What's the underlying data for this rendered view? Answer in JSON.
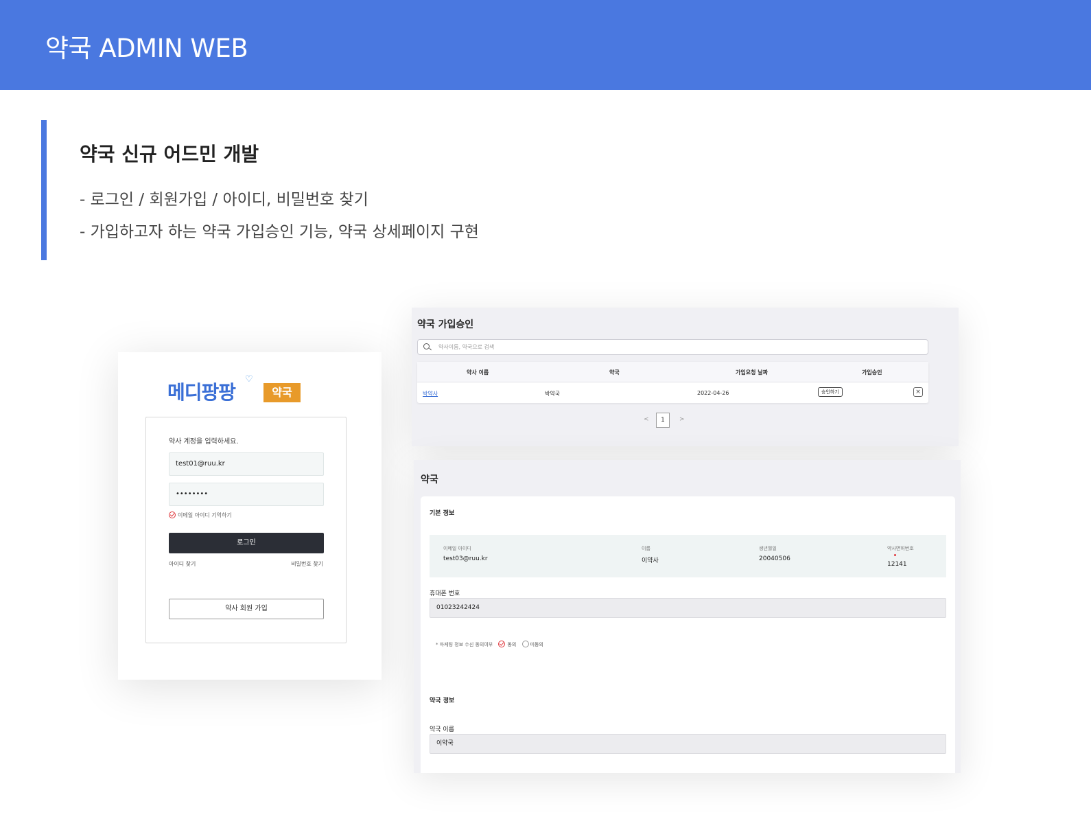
{
  "header": {
    "title": "약국 ADMIN WEB"
  },
  "section": {
    "heading": "약국 신규 어드민 개발",
    "bullets": [
      "- 로그인 / 회원가입 / 아이디, 비밀번호 찾기",
      "- 가입하고자 하는 약국 가입승인 기능, 약국 상세페이지 구현"
    ]
  },
  "login": {
    "logo_brand": "메디팡팡",
    "logo_tag": "약국",
    "prompt": "약사 계정을 입력하세요.",
    "email_value": "test01@ruu.kr",
    "password_value": "••••••••",
    "remember_label": "이메일 아이디 기억하기",
    "login_button": "로그인",
    "find_id": "아이디 찾기",
    "find_password": "비밀번호 찾기",
    "join_button": "약사 회원 가입"
  },
  "approval": {
    "title": "약국 가입승인",
    "search_placeholder": "약사이름, 약국으로 검색",
    "columns": [
      "약사 이름",
      "약국",
      "가입요청 날짜",
      "가입승인"
    ],
    "rows": [
      {
        "pharmacist": "박약사",
        "pharmacy": "박약국",
        "date": "2022-04-26",
        "approve_label": "승인하기",
        "reject_icon": "close-icon"
      }
    ],
    "pager": {
      "prev": "<",
      "current": "1",
      "next": ">"
    }
  },
  "detail": {
    "title": "약국",
    "basic_title": "기본 정보",
    "info": [
      {
        "label": "이메일 아이디",
        "value": "test03@ruu.kr"
      },
      {
        "label": "이름",
        "value": "이약사"
      },
      {
        "label": "생년월일",
        "value": "20040506"
      },
      {
        "label": "약사면허번호",
        "value": "12141"
      }
    ],
    "phone_label": "휴대폰 번호",
    "phone_value": "01023242424",
    "consent_label": "* 마케팅 정보 수신 동의여부",
    "consent_yes": "동의",
    "consent_no": "미동의",
    "pharmacy_title": "약국 정보",
    "pharmacy_name_label": "약국 이름",
    "pharmacy_name_value": "이약국"
  },
  "colors": {
    "accent": "#4a78e0",
    "logo_tag": "#e89a2a",
    "button_dark": "#2b2e36",
    "check_red": "#e0393e"
  }
}
